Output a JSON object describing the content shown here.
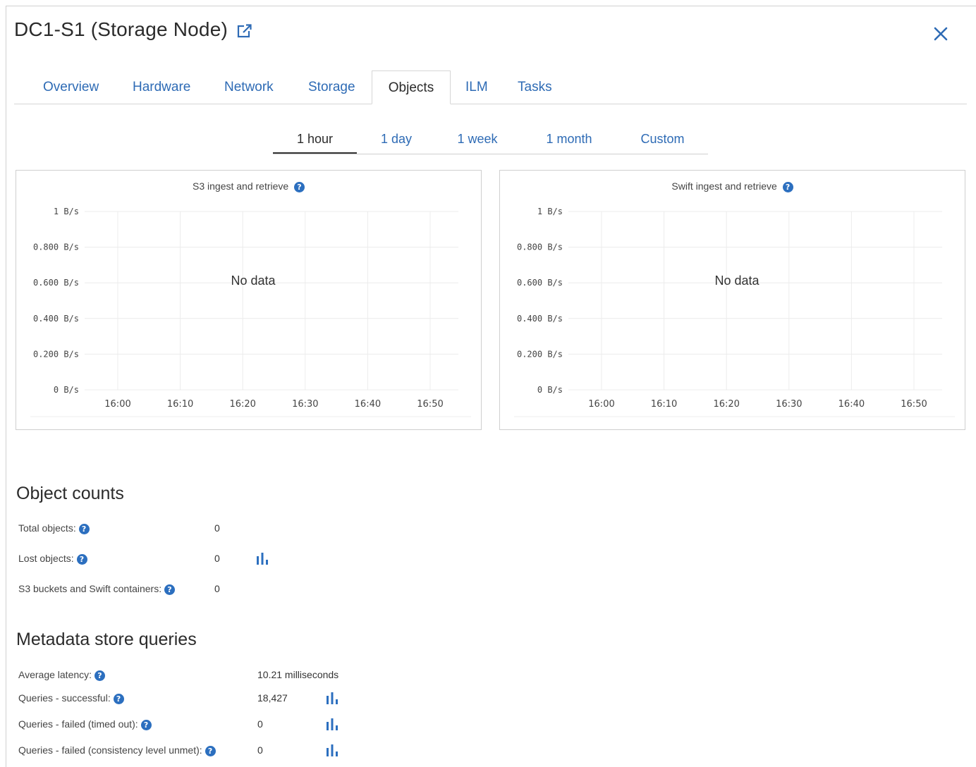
{
  "header": {
    "title": "DC1-S1 (Storage Node)",
    "external_link_icon": "external-link-icon",
    "close_icon": "close-icon"
  },
  "tabs": [
    {
      "label": "Overview"
    },
    {
      "label": "Hardware"
    },
    {
      "label": "Network"
    },
    {
      "label": "Storage"
    },
    {
      "label": "Objects",
      "active": true
    },
    {
      "label": "ILM"
    },
    {
      "label": "Tasks"
    }
  ],
  "time_ranges": [
    {
      "label": "1 hour",
      "active": true
    },
    {
      "label": "1 day"
    },
    {
      "label": "1 week"
    },
    {
      "label": "1 month"
    },
    {
      "label": "Custom"
    }
  ],
  "charts": {
    "s3": {
      "title": "S3 ingest and retrieve",
      "no_data": "No data"
    },
    "swift": {
      "title": "Swift ingest and retrieve",
      "no_data": "No data"
    }
  },
  "chart_data": [
    {
      "type": "line",
      "title": "S3 ingest and retrieve",
      "x": [
        "16:00",
        "16:10",
        "16:20",
        "16:30",
        "16:40",
        "16:50"
      ],
      "y_ticks": [
        "1 B/s",
        "0.800 B/s",
        "0.600 B/s",
        "0.400 B/s",
        "0.200 B/s",
        "0 B/s"
      ],
      "ylim": [
        0,
        1
      ],
      "series": [],
      "grid": true,
      "annotation": "No data"
    },
    {
      "type": "line",
      "title": "Swift ingest and retrieve",
      "x": [
        "16:00",
        "16:10",
        "16:20",
        "16:30",
        "16:40",
        "16:50"
      ],
      "y_ticks": [
        "1 B/s",
        "0.800 B/s",
        "0.600 B/s",
        "0.400 B/s",
        "0.200 B/s",
        "0 B/s"
      ],
      "ylim": [
        0,
        1
      ],
      "series": [],
      "grid": true,
      "annotation": "No data"
    }
  ],
  "object_counts": {
    "heading": "Object counts",
    "rows": [
      {
        "label": "Total objects:",
        "value": "0"
      },
      {
        "label": "Lost objects:",
        "value": "0",
        "chart_icon": "bar-chart-icon"
      },
      {
        "label": "S3 buckets and Swift containers:",
        "value": "0"
      }
    ]
  },
  "metadata_queries": {
    "heading": "Metadata store queries",
    "rows": [
      {
        "label": "Average latency:",
        "value": "10.21 milliseconds"
      },
      {
        "label": "Queries - successful:",
        "value": "18,427",
        "chart_icon": "bar-chart-icon"
      },
      {
        "label": "Queries - failed (timed out):",
        "value": "0",
        "chart_icon": "bar-chart-icon"
      },
      {
        "label": "Queries - failed (consistency level unmet):",
        "value": "0",
        "chart_icon": "bar-chart-icon"
      }
    ]
  },
  "help_glyph": "?",
  "colors": {
    "link": "#2e6bb5",
    "help_icon": "#2c6fbf",
    "chart_icon": "#2c6fbf"
  }
}
